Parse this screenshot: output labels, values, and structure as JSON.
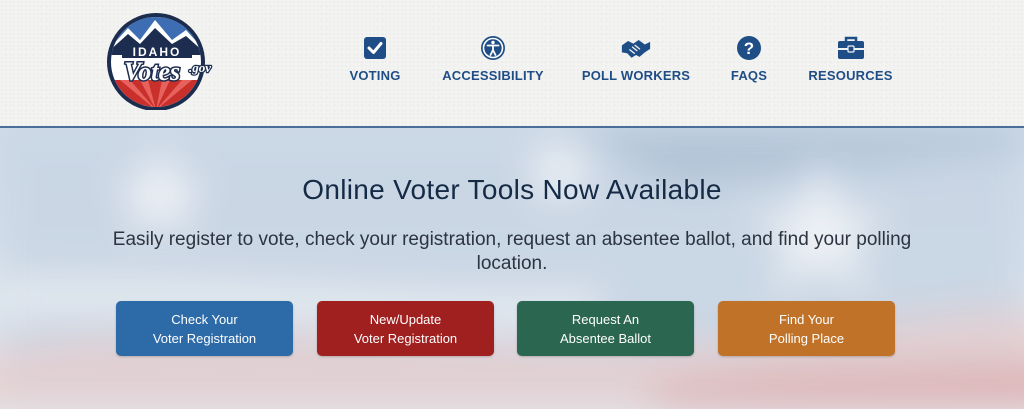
{
  "logo": {
    "line1": "IDAHO",
    "line2": "Votes",
    "line3": ".gov"
  },
  "nav": [
    {
      "label": "VOTING",
      "icon": "checkbox-icon"
    },
    {
      "label": "ACCESSIBILITY",
      "icon": "accessibility-icon"
    },
    {
      "label": "POLL WORKERS",
      "icon": "handshake-icon"
    },
    {
      "label": "FAQS",
      "icon": "question-icon"
    },
    {
      "label": "RESOURCES",
      "icon": "toolbox-icon"
    }
  ],
  "hero": {
    "title": "Online Voter Tools Now Available",
    "subtitle": "Easily register to vote, check your registration, request an absentee ballot, and find your polling location."
  },
  "buttons": [
    {
      "line1": "Check Your",
      "line2": "Voter Registration",
      "color": "#2d6aa8"
    },
    {
      "line1": "New/Update",
      "line2": "Voter Registration",
      "color": "#a01f1f"
    },
    {
      "line1": "Request An",
      "line2": "Absentee Ballot",
      "color": "#2a6650"
    },
    {
      "line1": "Find Your",
      "line2": "Polling Place",
      "color": "#c07228"
    }
  ],
  "colors": {
    "nav_text": "#1f4e86",
    "header_border": "#4a6d9a"
  }
}
